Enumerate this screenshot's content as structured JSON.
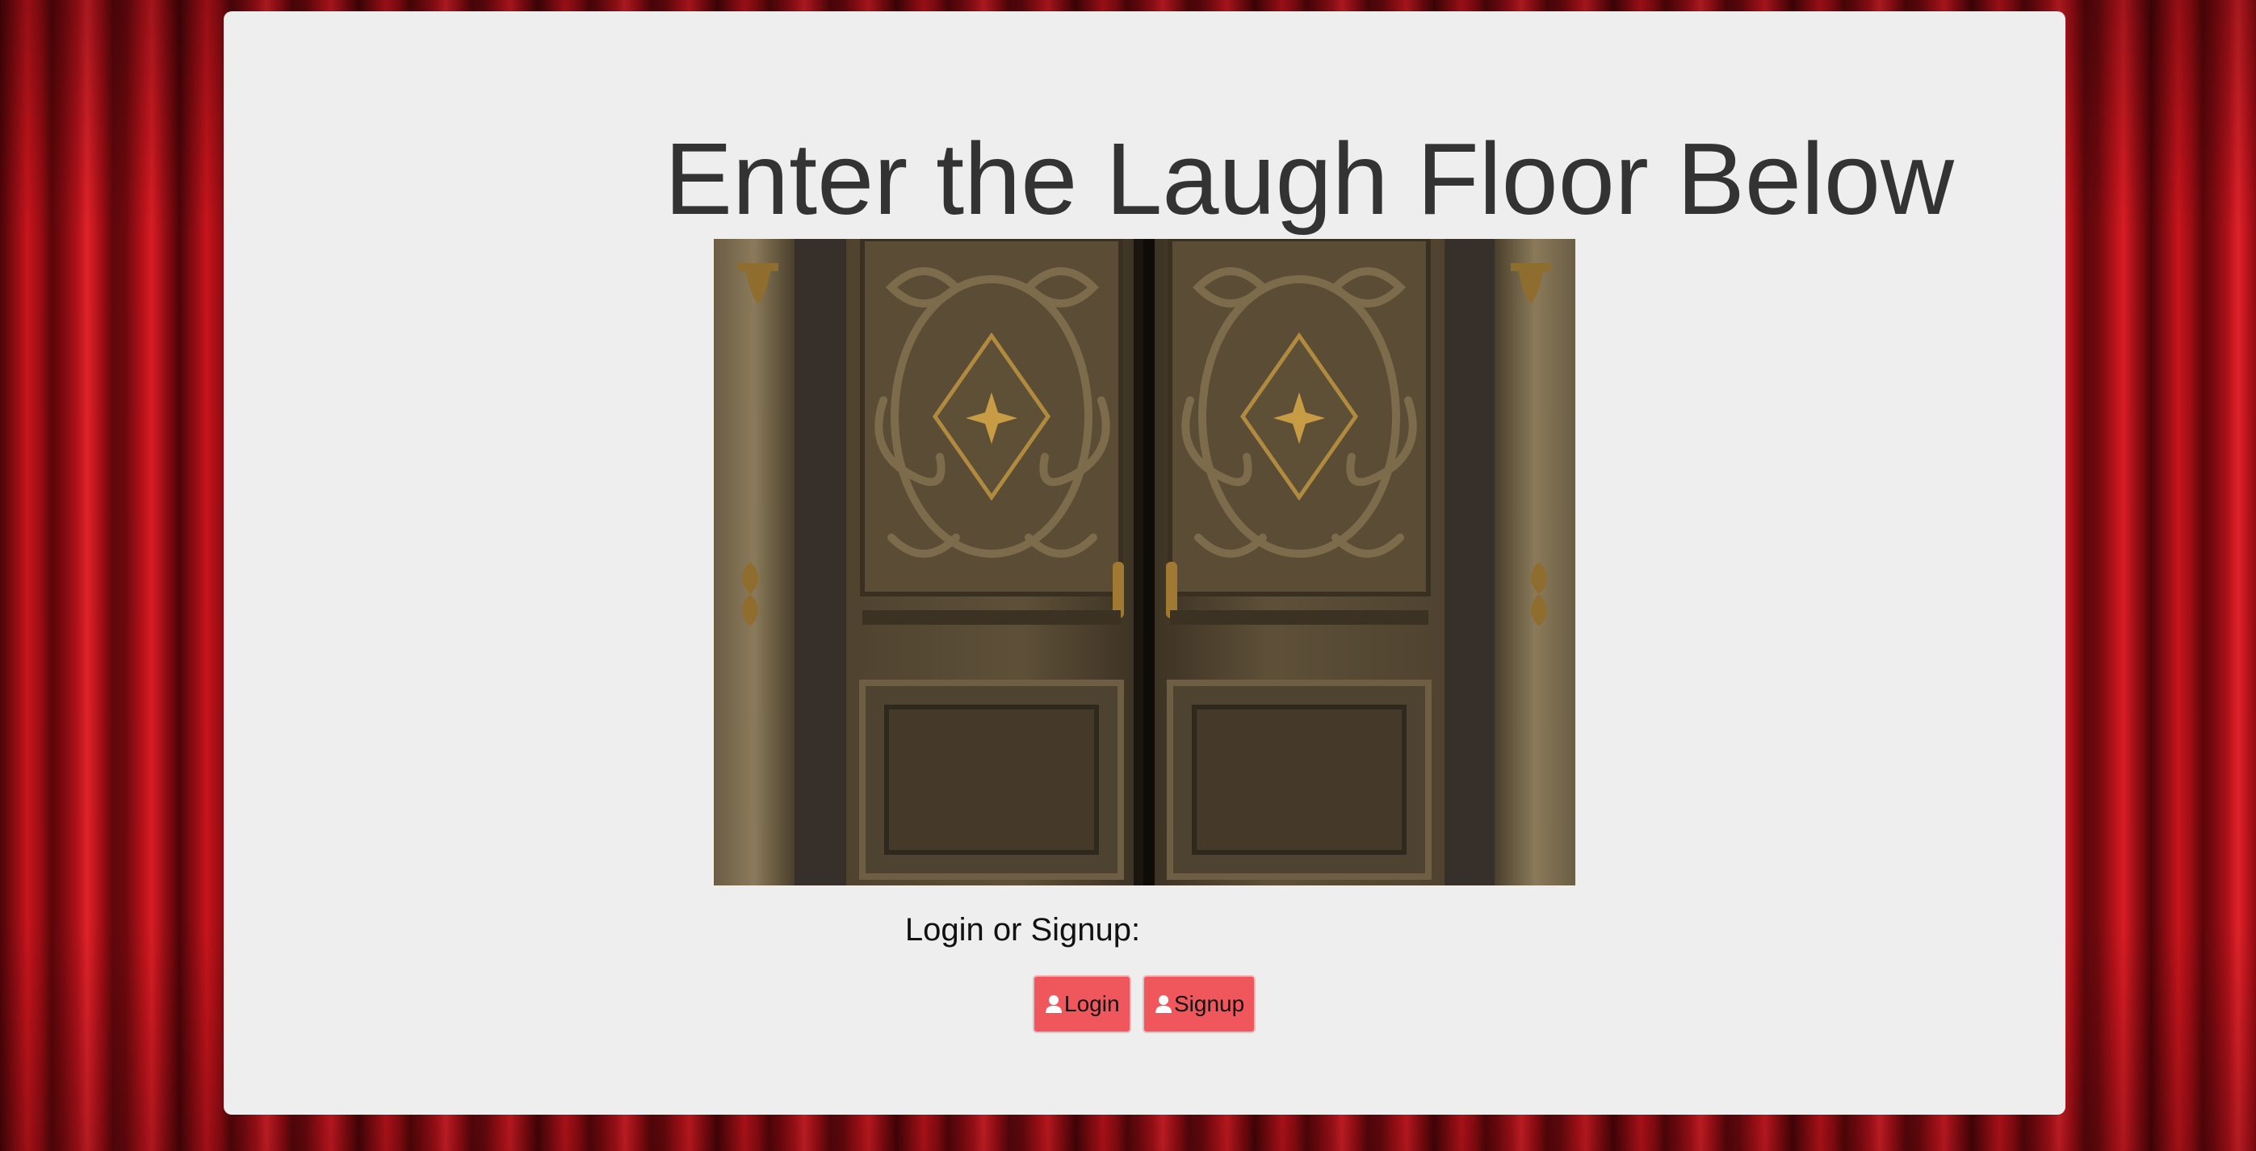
{
  "page": {
    "heading": "Enter the Laugh Floor Below",
    "prompt": "Login or Signup:"
  },
  "buttons": {
    "login_label": "Login",
    "signup_label": "Signup",
    "icon": "user-icon",
    "color": "#f0575d"
  },
  "image": {
    "subject": "wooden double doors",
    "alt": "Ornate wooden double doors"
  },
  "theme": {
    "background": "red theater curtain",
    "panel_color": "#eeeeee",
    "heading_color": "#333333"
  }
}
